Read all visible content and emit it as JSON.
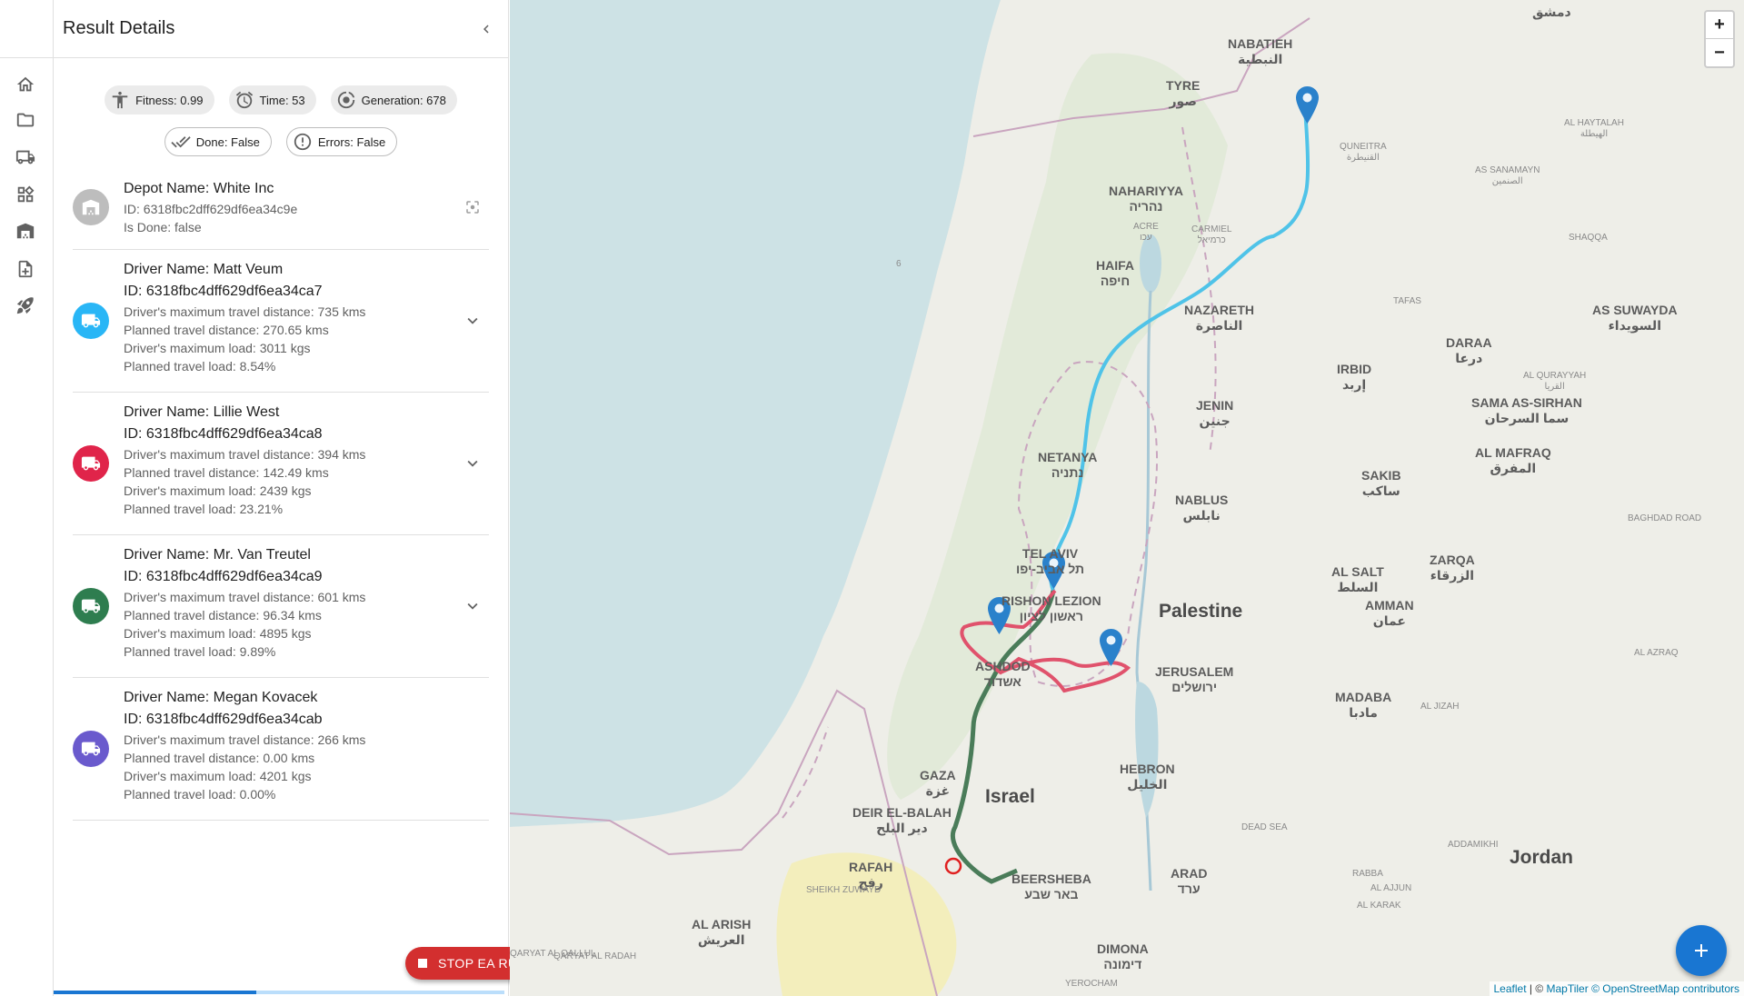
{
  "drawer": {
    "title": "Result Details"
  },
  "stats": {
    "fitness": "Fitness: 0.99",
    "time": "Time: 53",
    "generation": "Generation: 678",
    "done": "Done: False",
    "errors": "Errors: False"
  },
  "depot": {
    "name": "Depot Name: White Inc",
    "id": "ID: 6318fbc2dff629df6ea34c9e",
    "is_done": "Is Done: false"
  },
  "drivers": [
    {
      "name": "Driver Name: Matt Veum",
      "id": "ID: 6318fbc4dff629df6ea34ca7",
      "max_distance": "Driver's maximum travel distance: 735 kms",
      "planned_distance": "Planned travel distance: 270.65 kms",
      "max_load": "Driver's maximum load: 3011 kgs",
      "planned_load": "Planned travel load: 8.54%",
      "color": "#29b6f6"
    },
    {
      "name": "Driver Name: Lillie West",
      "id": "ID: 6318fbc4dff629df6ea34ca8",
      "max_distance": "Driver's maximum travel distance: 394 kms",
      "planned_distance": "Planned travel distance: 142.49 kms",
      "max_load": "Driver's maximum load: 2439 kgs",
      "planned_load": "Planned travel load: 23.21%",
      "color": "#e0244a"
    },
    {
      "name": "Driver Name: Mr. Van Treutel",
      "id": "ID: 6318fbc4dff629df6ea34ca9",
      "max_distance": "Driver's maximum travel distance: 601 kms",
      "planned_distance": "Planned travel distance: 96.34 kms",
      "max_load": "Driver's maximum load: 4895 kgs",
      "planned_load": "Planned travel load: 9.89%",
      "color": "#2e7d4f"
    },
    {
      "name": "Driver Name: Megan Kovacek",
      "id": "ID: 6318fbc4dff629df6ea34cab",
      "max_distance": "Driver's maximum travel distance: 266 kms",
      "planned_distance": "Planned travel distance: 0.00 kms",
      "max_load": "Driver's maximum load: 4201 kgs",
      "planned_load": "Planned travel load: 0.00%",
      "color": "#6a5acd"
    }
  ],
  "actions": {
    "stop": "STOP EA RUN"
  },
  "progress": {
    "value_percent": 45
  },
  "map": {
    "zoom_in": "+",
    "zoom_out": "−",
    "attribution_leaflet": "Leaflet",
    "attribution_sep": " | © ",
    "attribution_maptiler": "MapTiler",
    "attribution_osm": "© OpenStreetMap contributors",
    "labels": {
      "damascus": "دمشق",
      "nabatieh": "NABATIEH",
      "nabatieh_ar": "النبطية",
      "tyre": "TYRE",
      "tyre_ar": "صور",
      "al_haytalah": "AL HAYTALAH",
      "al_haytalah_ar": "الهيطلة",
      "quneitra": "QUNEITRA",
      "quneitra_ar": "القنيطرة",
      "as_sanamayn": "AS SANAMAYN",
      "as_sanamayn_ar": "الصنمين",
      "nahariyya": "NAHARIYYA",
      "nahariyya_he": "נהריה",
      "acre": "ACRE",
      "acre_he": "עכו",
      "carmiel": "CARMIEL",
      "carmiel_he": "כרמיאל",
      "haifa": "HAIFA",
      "haifa_he": "חיפה",
      "nazareth": "NAZARETH",
      "nazareth_ar": "الناصرة",
      "shaqqa": "SHAQQA",
      "tafas": "TAFAS",
      "as_suwayda": "AS SUWAYDA",
      "as_suwayda_ar": "السويداء",
      "daraa": "DARAA",
      "daraa_ar": "درعا",
      "irbid": "IRBID",
      "irbid_ar": "إربد",
      "al_qurayyah": "AL QURAYYAH",
      "al_qurayyah_ar": "القريا",
      "sama_as_sirhan": "SAMA AS-SIRHAN",
      "sama_as_sirhan_ar": "سما السرحان",
      "jenin": "JENIN",
      "jenin_ar": "جنين",
      "netanya": "NETANYA",
      "netanya_he": "נתניה",
      "al_mafraq": "AL MAFRAQ",
      "al_mafraq_ar": "المفرق",
      "nablus": "NABLUS",
      "nablus_ar": "نابلس",
      "sakib": "SAKIB",
      "sakib_ar": "ساكب",
      "tel_aviv": "TEL AVIV",
      "tel_aviv_he": "תל אביב-יפו",
      "al_salt": "AL SALT",
      "al_salt_ar": "السلط",
      "zarqa": "ZARQA",
      "zarqa_ar": "الزرقاء",
      "rishon": "RISHON LEZION",
      "rishon_he": "ראשון לציון",
      "palestine": "Palestine",
      "amman": "AMMAN",
      "amman_ar": "عمان",
      "ashdod": "ASHDOD",
      "ashdod_he": "אשדוד",
      "jerusalem": "JERUSALEM",
      "jerusalem_he": "ירושלים",
      "madaba": "MADABA",
      "madaba_ar": "مادبا",
      "al_jizah": "AL JIZAH",
      "gaza": "GAZA",
      "gaza_ar": "غزة",
      "israel": "Israel",
      "hebron": "HEBRON",
      "hebron_ar": "الخليل",
      "deir": "DEIR EL-BALAH",
      "deir_ar": "دير البلح",
      "rafah": "RAFAH",
      "rafah_ar": "رفح",
      "beersheba": "BEERSHEBA",
      "beersheba_he": "באר שבע",
      "arad": "ARAD",
      "arad_he": "ערד",
      "jordan": "Jordan",
      "al_arish": "AL ARISH",
      "al_arish_ar": "العريش",
      "dimona": "DIMONA",
      "dimona_he": "דימונה",
      "sheikh_zuwayd": "SHEIKH ZUWAYD",
      "qaryat_al_qallul": "QARYAT AL QALLUL",
      "qaryat_al_radah": "QARYAT AL RADAH",
      "yerocham": "YEROCHAM",
      "addamikhi": "ADDAMIKHI",
      "al_ajjun": "AL AJJUN",
      "al_karak": "AL KARAK",
      "rabba": "RABBA",
      "al_azraq": "AL AZRAQ",
      "baghdad_road": "BAGHDAD ROAD",
      "dead_sea": "DEAD SEA",
      "route_6": "6"
    }
  }
}
